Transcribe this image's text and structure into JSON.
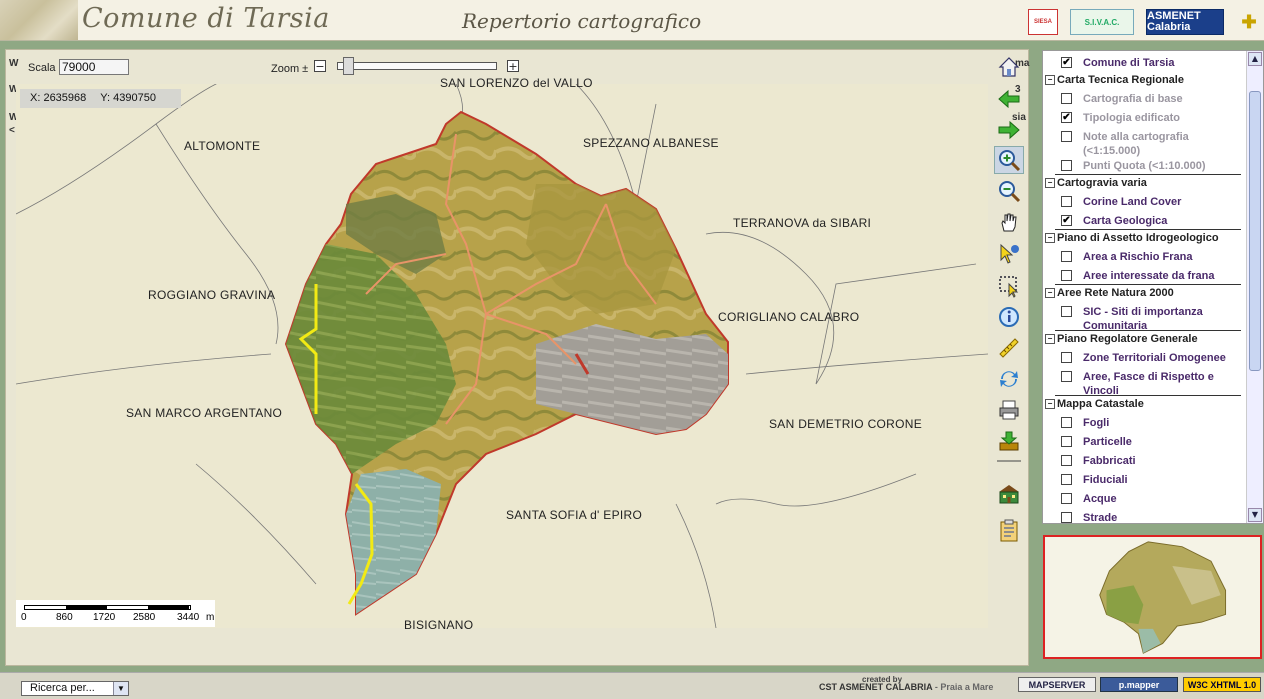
{
  "header": {
    "title": "Comune di Tarsia",
    "subtitle": "Repertorio cartografico",
    "logos": [
      "SIESA",
      "S.I.V.A.C.",
      "ASMENET Calabria"
    ]
  },
  "map": {
    "scale_label": "Scala",
    "scale_value": "79000",
    "zoom_label": "Zoom ±",
    "zoom_minus": "−",
    "zoom_plus": "+",
    "coord_x": "X: 2635968",
    "coord_y": "Y: 4390750",
    "places": {
      "san_lorenzo": "SAN LORENZO del VALLO",
      "altomonte": "ALTOMONTE",
      "spezzano": "SPEZZANO ALBANESE",
      "terranova": "TERRANOVA da SIBARI",
      "roggiano": "ROGGIANO GRAVINA",
      "corigliano": "CORIGLIANO CALABRO",
      "san_marco": "SAN MARCO ARGENTANO",
      "san_demetrio": "SAN DEMETRIO CORONE",
      "santa_sofia": "SANTA SOFIA d' EPIRO",
      "bisignano": "BISIGNANO"
    },
    "scalebar": {
      "labels": [
        "0",
        "860",
        "1720",
        "2580",
        "3440"
      ],
      "unit": "m"
    },
    "background_fragments": {
      "w1": "W",
      "w2": "W",
      "w3": "W",
      "ma": "ma",
      "three": "3",
      "sia": "sia",
      "lt": "<"
    }
  },
  "toolbar": {
    "icons": [
      "home-icon",
      "back-arrow-icon",
      "forward-arrow-icon",
      "zoom-in-icon",
      "zoom-out-icon",
      "pan-hand-icon",
      "identify-pointer-icon",
      "select-rectangle-icon",
      "info-icon",
      "measure-ruler-icon",
      "refresh-icon",
      "print-icon",
      "download-icon",
      "building-icon",
      "clipboard-icon"
    ],
    "active": "zoom-in-icon"
  },
  "toc": {
    "top_layer": {
      "label": "Comune di Tarsia",
      "checked": true
    },
    "groups": [
      {
        "name": "Carta Tecnica Regionale",
        "layers": [
          {
            "label": "Cartografia di base",
            "checked": false,
            "disabled": true
          },
          {
            "label": "Tipologia edificato",
            "checked": true,
            "disabled": true
          },
          {
            "label": "Note alla cartografia (<1:15.000)",
            "checked": false,
            "disabled": true
          },
          {
            "label": "Punti Quota (<1:10.000)",
            "checked": false,
            "disabled": true
          }
        ]
      },
      {
        "name": "Cartogravia varia",
        "layers": [
          {
            "label": "Corine Land Cover",
            "checked": false,
            "disabled": false
          },
          {
            "label": "Carta Geologica",
            "checked": true,
            "disabled": false
          }
        ]
      },
      {
        "name": "Piano di Assetto Idrogeologico",
        "layers": [
          {
            "label": "Area a Rischio Frana",
            "checked": false,
            "disabled": false
          },
          {
            "label": "Aree interessate da frana",
            "checked": false,
            "disabled": false
          }
        ]
      },
      {
        "name": "Aree Rete Natura 2000",
        "layers": [
          {
            "label": "SIC - Siti di importanza Comunitaria",
            "checked": false,
            "disabled": false
          }
        ]
      },
      {
        "name": "Piano Regolatore Generale",
        "layers": [
          {
            "label": "Zone Territoriali Omogenee",
            "checked": false,
            "disabled": false
          },
          {
            "label": "Aree, Fasce di Rispetto e Vincoli",
            "checked": false,
            "disabled": false
          }
        ]
      },
      {
        "name": "Mappa Catastale",
        "layers": [
          {
            "label": "Fogli",
            "checked": false,
            "disabled": false
          },
          {
            "label": "Particelle",
            "checked": false,
            "disabled": false
          },
          {
            "label": "Fabbricati",
            "checked": false,
            "disabled": false
          },
          {
            "label": "Fiduciali",
            "checked": false,
            "disabled": false
          },
          {
            "label": "Acque",
            "checked": false,
            "disabled": false
          },
          {
            "label": "Strade",
            "checked": false,
            "disabled": false
          }
        ]
      }
    ]
  },
  "footer": {
    "search_value": "Ricerca per...",
    "created_by": "created by",
    "credit": "CST  ASMENET CALABRIA",
    "credit_place": " - Praia a Mare",
    "badges": [
      "MAPSERVER",
      "p.mapper",
      "W3C XHTML 1.0"
    ]
  },
  "colors": {
    "accent": "#8fa884",
    "overview_border": "#dd2222",
    "layer_text": "#4a2a6a"
  }
}
